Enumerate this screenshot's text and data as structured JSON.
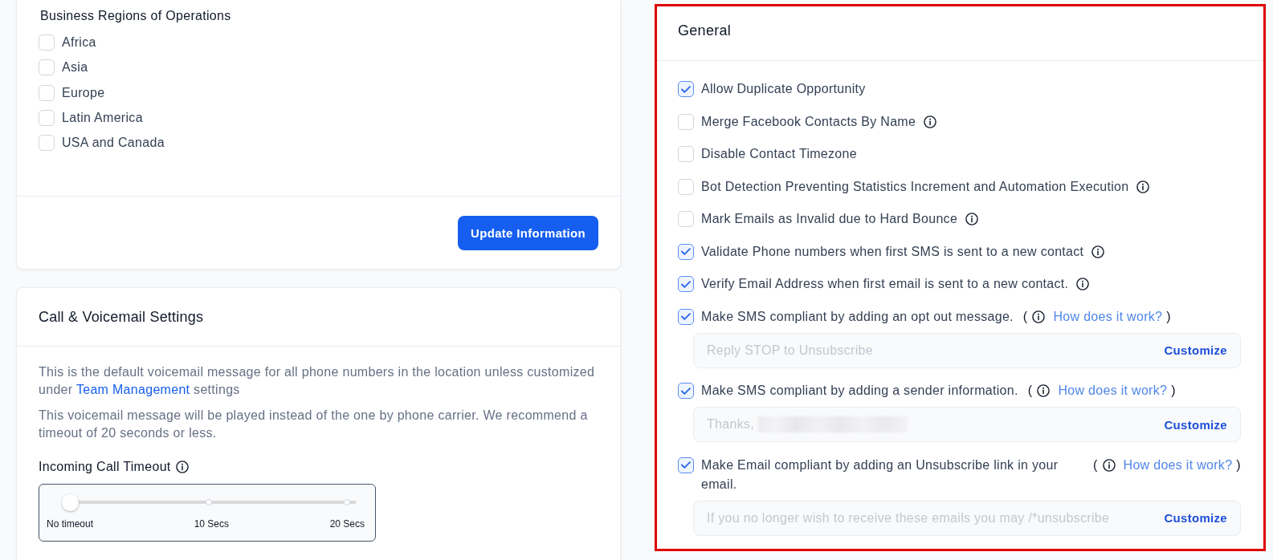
{
  "regions": {
    "title": "Business Regions of Operations",
    "options": [
      {
        "label": "Africa",
        "checked": false
      },
      {
        "label": "Asia",
        "checked": false
      },
      {
        "label": "Europe",
        "checked": false
      },
      {
        "label": "Latin America",
        "checked": false
      },
      {
        "label": "USA and Canada",
        "checked": false
      }
    ],
    "submit": "Update Information"
  },
  "call_voicemail": {
    "title": "Call & Voicemail Settings",
    "intro": {
      "before": "This is the default voicemail message for all phone numbers in the location unless customized under",
      "link": "Team Management",
      "after": "settings"
    },
    "note": "This voicemail message will be played instead of the one by phone carrier. We recommend a timeout of 20 seconds or less.",
    "timeout": {
      "label": "Incoming Call Timeout",
      "info": true,
      "level": 0,
      "marks": [
        "No timeout",
        "10 Secs",
        "20 Secs"
      ]
    }
  },
  "general": {
    "title": "General",
    "options": [
      {
        "label": "Allow Duplicate Opportunity",
        "checked": true,
        "info": false
      },
      {
        "label": "Merge Facebook Contacts By Name",
        "checked": false,
        "info": true
      },
      {
        "label": "Disable Contact Timezone",
        "checked": false,
        "info": false
      },
      {
        "label": "Bot Detection Preventing Statistics Increment and Automation Execution",
        "checked": false,
        "info": true
      },
      {
        "label": "Mark Emails as Invalid due to Hard Bounce",
        "checked": false,
        "info": true
      },
      {
        "label": "Validate Phone numbers when first SMS is sent to a new contact",
        "checked": true,
        "info": true
      },
      {
        "label": "Verify Email Address when first email is sent to a new contact.",
        "checked": true,
        "info": true
      },
      {
        "label": "Make SMS compliant by adding an opt out message.",
        "checked": true,
        "info": true,
        "help": {
          "open": "(",
          "link": "How does it work?",
          "close": ")"
        },
        "field": {
          "placeholder": "Reply STOP to Unsubscribe",
          "redacted": false,
          "action": "Customize"
        }
      },
      {
        "label": "Make SMS compliant by adding a sender information.",
        "checked": true,
        "info": true,
        "help": {
          "open": "(",
          "link": "How does it work?",
          "close": ")"
        },
        "field": {
          "placeholder": "Thanks,",
          "redacted": true,
          "action": "Customize"
        }
      },
      {
        "label": "Make Email compliant by adding an Unsubscribe link in your email.",
        "checked": true,
        "info": true,
        "help": {
          "open": "(",
          "link": "How does it work?",
          "close": ")"
        },
        "field": {
          "placeholder": "If you no longer wish to receive these emails you may /*unsubscribe",
          "redacted": false,
          "action": "Customize"
        }
      }
    ]
  }
}
